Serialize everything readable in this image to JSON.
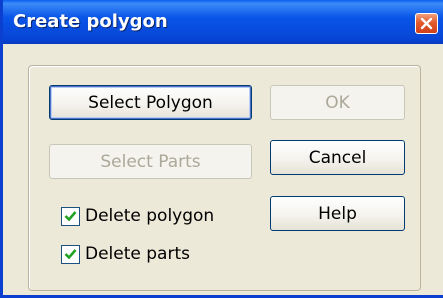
{
  "window": {
    "title": "Create polygon"
  },
  "buttons": {
    "select_polygon": "Select Polygon",
    "ok": "OK",
    "select_parts": "Select Parts",
    "cancel": "Cancel",
    "help": "Help"
  },
  "checkboxes": {
    "delete_polygon": {
      "label": "Delete polygon",
      "checked": true
    },
    "delete_parts": {
      "label": "Delete parts",
      "checked": true
    }
  },
  "colors": {
    "titlebar": "#0955e8",
    "close_button": "#e35a2e",
    "check_mark": "#21a121",
    "disabled_text": "#aca899"
  },
  "icons": {
    "close": "close-icon",
    "check": "check-icon"
  }
}
